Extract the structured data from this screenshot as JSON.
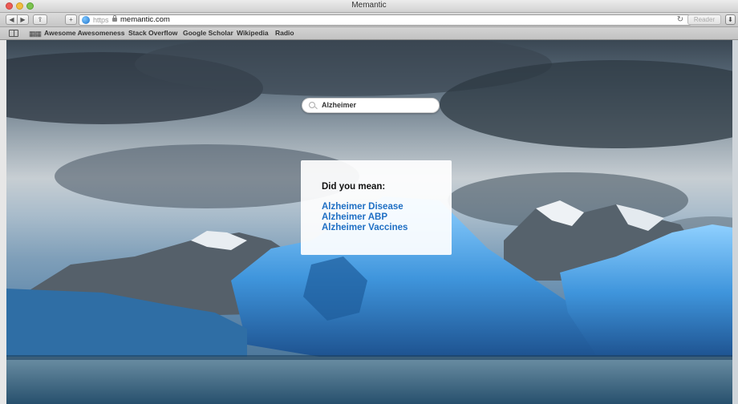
{
  "window": {
    "title": "Memantic"
  },
  "toolbar": {
    "url_scheme": "https",
    "url_host": "memantic.com",
    "reader_label": "Reader"
  },
  "bookmarks": [
    "Awesome Awesomeness",
    "Stack Overflow",
    "Google Scholar",
    "Wikipedia",
    "Radio"
  ],
  "search": {
    "value": "Alzheimer"
  },
  "suggestions": {
    "heading": "Did you mean:",
    "items": [
      "Alzheimer Disease",
      "Alzheimer ABP",
      "Alzheimer Vaccines"
    ]
  },
  "colors": {
    "link": "#1f6fc4",
    "panel_bg": "#ffffff"
  },
  "icons": [
    "close-icon",
    "minimize-icon",
    "zoom-icon",
    "back-icon",
    "forward-icon",
    "share-icon",
    "add-tab-icon",
    "globe-icon",
    "lock-icon",
    "reload-icon",
    "download-icon",
    "reading-list-icon",
    "top-sites-icon",
    "search-icon"
  ]
}
